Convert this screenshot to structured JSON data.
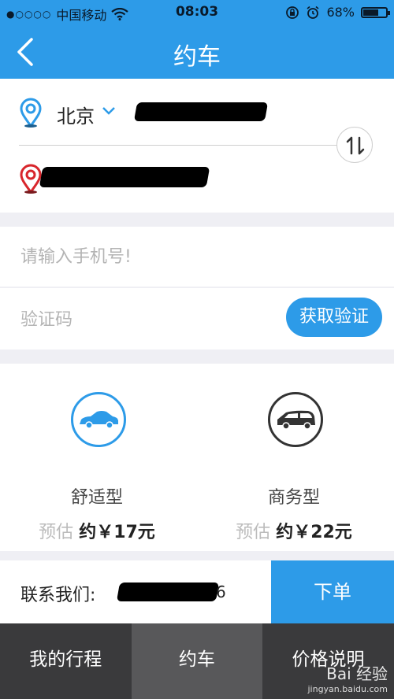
{
  "status_bar": {
    "signal_dots": "●○○○○",
    "carrier": "中国移动",
    "time": "08:03",
    "battery_percent": "68%",
    "battery_level": 0.68
  },
  "nav": {
    "title": "约车"
  },
  "route": {
    "origin_city": "北京"
  },
  "phone_form": {
    "phone_placeholder": "请输入手机号!",
    "code_placeholder": "验证码",
    "get_code_label": "获取验证"
  },
  "car_options": [
    {
      "name": "舒适型",
      "estimate_label": "预估",
      "price": "约￥17元",
      "icon": "sedan-icon",
      "color": "#2d9be8"
    },
    {
      "name": "商务型",
      "estimate_label": "预估",
      "price": "约￥22元",
      "icon": "van-icon",
      "color": "#333333"
    }
  ],
  "contact": {
    "label": "联系我们:",
    "number_suffix": "6"
  },
  "order_button": "下单",
  "tabs": [
    {
      "label": "我的行程",
      "active": false
    },
    {
      "label": "约车",
      "active": true
    },
    {
      "label": "价格说明",
      "active": false
    }
  ],
  "watermark": {
    "text": "Bai 经验",
    "sub": "jingyan.baidu.com"
  },
  "colors": {
    "accent": "#2d9be8",
    "tabbar": "#3a3a3c",
    "tab_active": "#58585a",
    "destination_pin": "#d8262c"
  }
}
